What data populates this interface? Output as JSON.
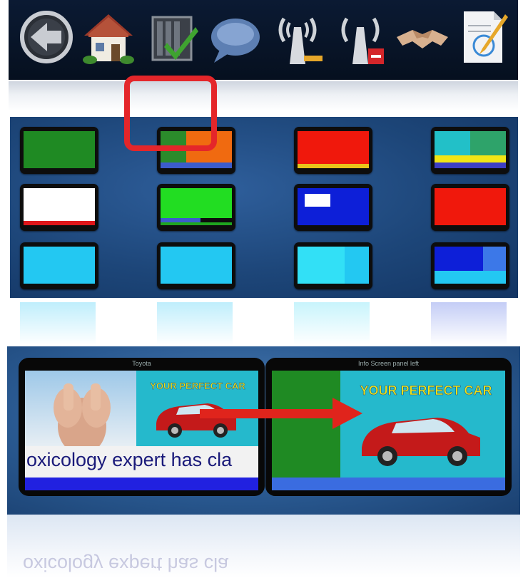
{
  "toolbar": {
    "icons": [
      "back-arrow-icon",
      "home-icon",
      "checklist-icon",
      "chat-bubble-icon",
      "antenna-signal-icon",
      "antenna-remove-icon",
      "handshake-icon",
      "edit-document-icon"
    ]
  },
  "preview": {
    "left_title": "Toyota",
    "right_title": "Info Screen panel left",
    "ticker_text": "oxicology expert has cla",
    "ad_headline": "YOUR PERFECT CAR",
    "reflection_text": "oxicology expert has cla"
  },
  "colors": {
    "toolbar_bg": "#0b1a33",
    "highlight": "#e4262a",
    "arrow": "#e0241c",
    "panel_blue": "#1d4679"
  }
}
